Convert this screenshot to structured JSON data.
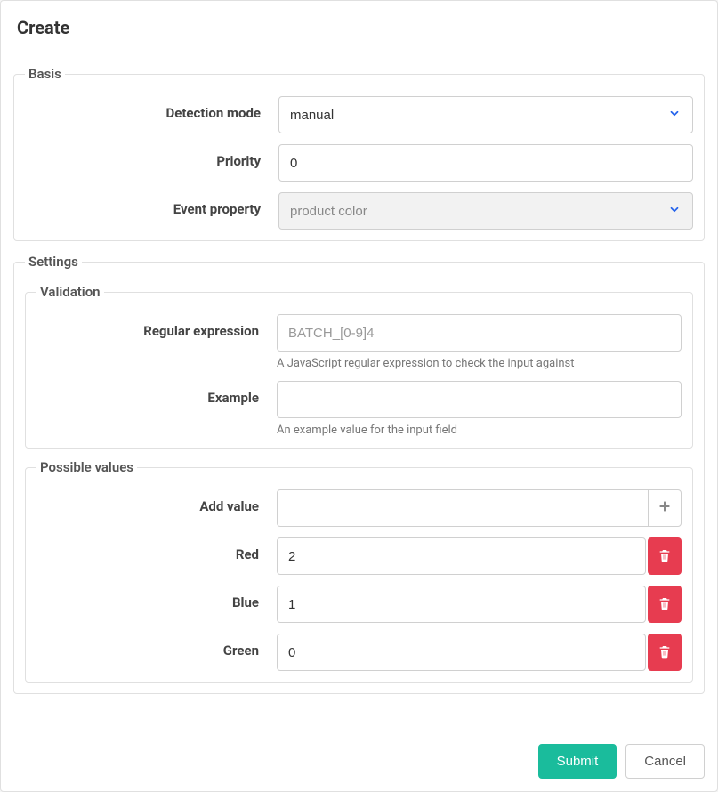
{
  "header": {
    "title": "Create"
  },
  "basis": {
    "legend": "Basis",
    "detection_mode": {
      "label": "Detection mode",
      "value": "manual"
    },
    "priority": {
      "label": "Priority",
      "value": "0"
    },
    "event_property": {
      "label": "Event property",
      "value": "product color"
    }
  },
  "settings": {
    "legend": "Settings",
    "validation": {
      "legend": "Validation",
      "regex": {
        "label": "Regular expression",
        "placeholder": "BATCH_[0-9]4",
        "help": "A JavaScript regular expression to check the input against",
        "value": ""
      },
      "example": {
        "label": "Example",
        "help": "An example value for the input field",
        "value": ""
      }
    },
    "possible_values": {
      "legend": "Possible values",
      "add_value": {
        "label": "Add value",
        "value": ""
      },
      "items": [
        {
          "label": "Red",
          "value": "2"
        },
        {
          "label": "Blue",
          "value": "1"
        },
        {
          "label": "Green",
          "value": "0"
        }
      ]
    }
  },
  "footer": {
    "submit": "Submit",
    "cancel": "Cancel"
  }
}
